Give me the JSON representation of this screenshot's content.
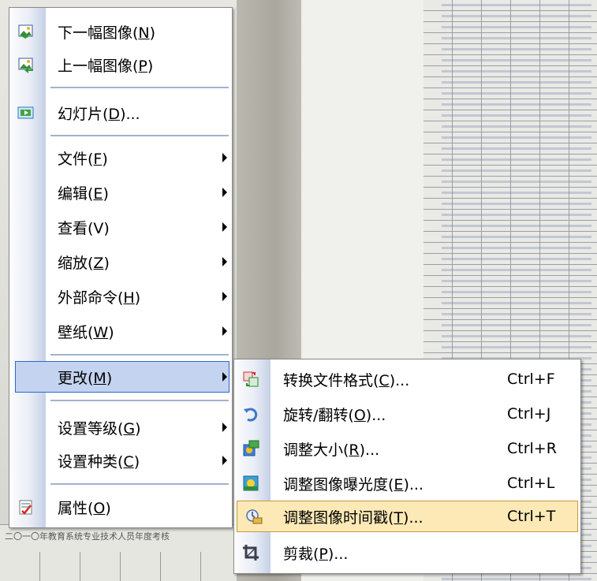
{
  "background": {
    "caption": "二〇一〇年教育系统专业技术人员年度考核"
  },
  "menu": {
    "items": [
      {
        "icon": "next-image-icon",
        "pre": "下一幅图像(",
        "key": "N",
        "post": ")"
      },
      {
        "icon": "prev-image-icon",
        "pre": "上一幅图像(",
        "key": "P",
        "post": ")"
      },
      {
        "icon": "slideshow-icon",
        "pre": "幻灯片(",
        "key": "D",
        "post": ")..."
      },
      {
        "pre": "文件(",
        "key": "F",
        "post": ")"
      },
      {
        "pre": "编辑(",
        "key": "E",
        "post": ")"
      },
      {
        "pre": "查看(",
        "key": "V",
        "post": ")"
      },
      {
        "pre": "缩放(",
        "key": "Z",
        "post": ")"
      },
      {
        "pre": "外部命令(",
        "key": "H",
        "post": ")"
      },
      {
        "pre": "壁纸(",
        "key": "W",
        "post": ")"
      },
      {
        "pre": "更改(",
        "key": "M",
        "post": ")"
      },
      {
        "pre": "设置等级(",
        "key": "G",
        "post": ")"
      },
      {
        "pre": "设置种类(",
        "key": "C",
        "post": ")"
      },
      {
        "icon": "properties-icon",
        "pre": "属性(",
        "key": "O",
        "post": ")"
      }
    ]
  },
  "submenu": {
    "items": [
      {
        "icon": "convert-format-icon",
        "pre": "转换文件格式(",
        "key": "C",
        "post": ")...",
        "shortcut": "Ctrl+F"
      },
      {
        "icon": "rotate-icon",
        "pre": "旋转/翻转(",
        "key": "O",
        "post": ")...",
        "shortcut": "Ctrl+J"
      },
      {
        "icon": "resize-icon",
        "pre": "调整大小(",
        "key": "R",
        "post": ")...",
        "shortcut": "Ctrl+R"
      },
      {
        "icon": "exposure-icon",
        "pre": "调整图像曝光度(",
        "key": "E",
        "post": ")...",
        "shortcut": "Ctrl+L"
      },
      {
        "icon": "timestamp-icon",
        "pre": "调整图像时间戳(",
        "key": "T",
        "post": ")...",
        "shortcut": "Ctrl+T"
      },
      {
        "icon": "crop-icon",
        "pre": "剪裁(",
        "key": "P",
        "post": ")..."
      }
    ]
  }
}
